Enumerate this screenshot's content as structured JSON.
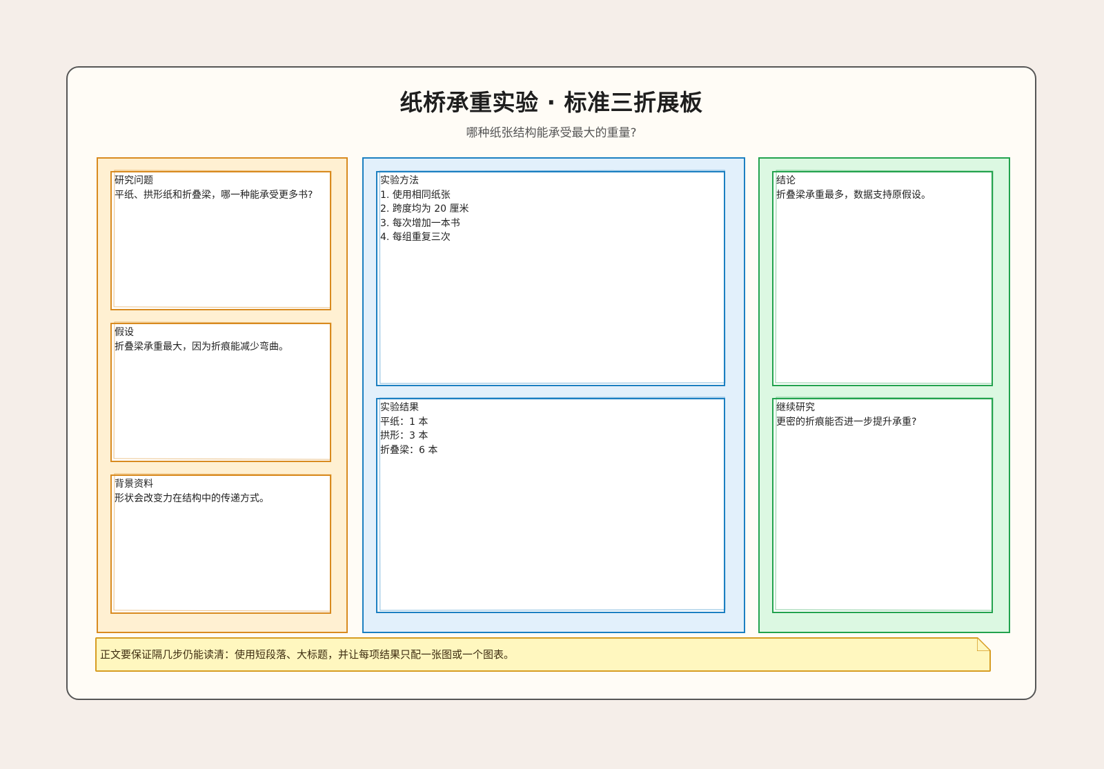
{
  "board": {
    "title": "纸桥承重实验 · 标准三折展板",
    "subtitle": "哪种纸张结构能承受最大的重量?"
  },
  "columns": {
    "left": {
      "color": "#d88a1f",
      "cards": [
        {
          "heading": "研究问题",
          "lines": [
            "平纸、拱形纸和折叠梁，哪一种能承受更多书?"
          ]
        },
        {
          "heading": "假设",
          "lines": [
            "折叠梁承重最大，因为折痕能减少弯曲。"
          ]
        },
        {
          "heading": "背景资料",
          "lines": [
            "形状会改变力在结构中的传递方式。"
          ]
        }
      ]
    },
    "middle": {
      "color": "#1b7fc1",
      "cards": [
        {
          "heading": "实验方法",
          "lines": [
            "1. 使用相同纸张",
            "2. 跨度均为 20 厘米",
            "3. 每次增加一本书",
            "4. 每组重复三次"
          ]
        },
        {
          "heading": "实验结果",
          "lines": [
            "平纸：1 本",
            "拱形：3 本",
            "折叠梁：6 本"
          ]
        }
      ]
    },
    "right": {
      "color": "#22a24d",
      "cards": [
        {
          "heading": "结论",
          "lines": [
            "折叠梁承重最多，数据支持原假设。"
          ]
        },
        {
          "heading": "继续研究",
          "lines": [
            "更密的折痕能否进一步提升承重?"
          ]
        }
      ]
    }
  },
  "note": {
    "text": "正文要保证隔几步仍能读清：使用短段落、大标题，并让每项结果只配一张图或一个图表。"
  }
}
